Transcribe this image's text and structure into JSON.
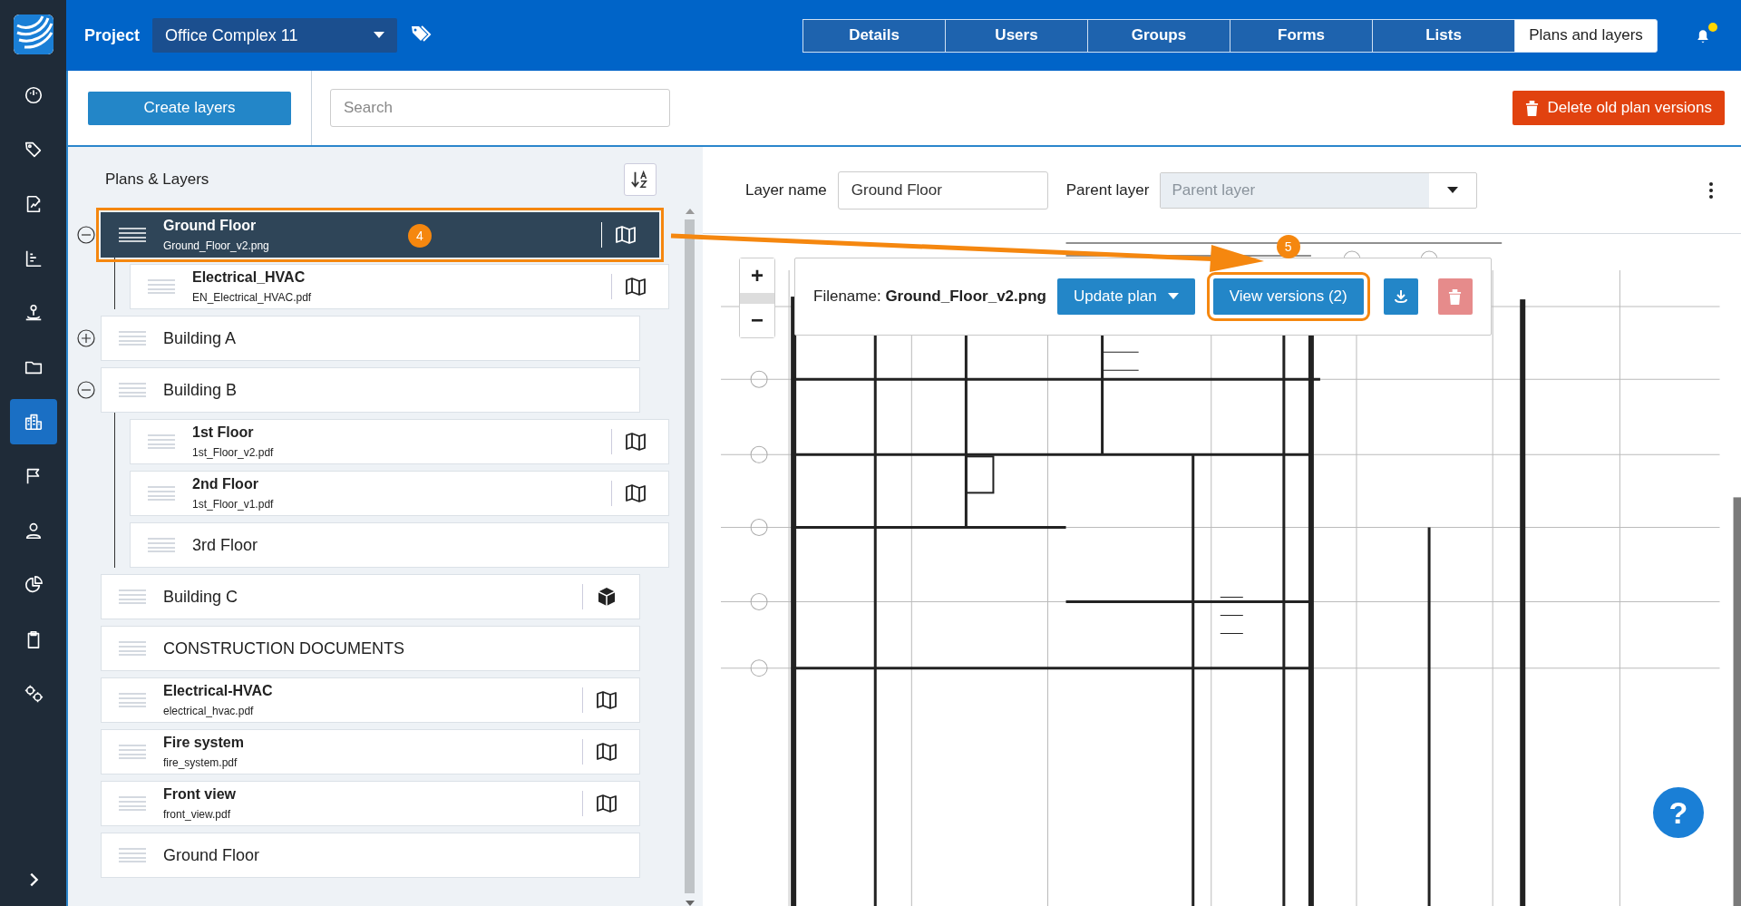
{
  "sidebar": {
    "items": [
      {
        "selected": false
      },
      {
        "selected": false
      },
      {
        "selected": false
      },
      {
        "selected": false
      },
      {
        "selected": false
      },
      {
        "selected": false
      },
      {
        "selected": true
      },
      {
        "selected": false
      },
      {
        "selected": false
      },
      {
        "selected": false
      },
      {
        "selected": false
      },
      {
        "selected": false
      }
    ]
  },
  "header": {
    "project_label": "Project",
    "project": "Office Complex 11",
    "tabs": [
      {
        "label": "Details",
        "selected": false
      },
      {
        "label": "Users",
        "selected": false
      },
      {
        "label": "Groups",
        "selected": false
      },
      {
        "label": "Forms",
        "selected": false
      },
      {
        "label": "Lists",
        "selected": false
      },
      {
        "label": "Plans and layers",
        "selected": true
      }
    ],
    "notifications": {
      "unread": true
    }
  },
  "toolbar": {
    "create_button": "Create layers",
    "search": {
      "placeholder": "Search"
    },
    "delete_button": "Delete old plan versions"
  },
  "tree": {
    "title": "Plans & Layers",
    "items": [
      {
        "name": "Ground Floor",
        "file": "Ground_Floor_v2.png",
        "kind": "plan",
        "selected": true,
        "callout": "4",
        "expanded": true,
        "children": [
          {
            "name": "Electrical_HVAC",
            "file": "EN_Electrical_HVAC.pdf",
            "kind": "plan",
            "selected": false
          }
        ]
      },
      {
        "name": "Building A",
        "kind": "folder",
        "selected": false,
        "expanded": false
      },
      {
        "name": "Building B",
        "kind": "folder",
        "selected": false,
        "expanded": true,
        "children": [
          {
            "name": "1st Floor",
            "file": "1st_Floor_v2.pdf",
            "kind": "plan",
            "selected": false
          },
          {
            "name": "2nd Floor",
            "file": "1st_Floor_v1.pdf",
            "kind": "plan",
            "selected": false
          },
          {
            "name": "3rd Floor",
            "kind": "folder",
            "selected": false
          }
        ]
      },
      {
        "name": "Building C",
        "kind": "model",
        "selected": false
      },
      {
        "name": "CONSTRUCTION DOCUMENTS",
        "kind": "folder",
        "selected": false
      },
      {
        "name": "Electrical-HVAC",
        "file": "electrical_hvac.pdf",
        "kind": "plan",
        "selected": false
      },
      {
        "name": "Fire system",
        "file": "fire_system.pdf",
        "kind": "plan",
        "selected": false
      },
      {
        "name": "Front view",
        "file": "front_view.pdf",
        "kind": "plan",
        "selected": false
      },
      {
        "name": "Ground Floor",
        "kind": "folder",
        "selected": false
      }
    ]
  },
  "detail": {
    "layer_name_label": "Layer name",
    "layer_name": "Ground Floor",
    "parent_label": "Parent layer",
    "parent_placeholder": "Parent layer",
    "plan": {
      "kind": "picture",
      "zoom_in": "+",
      "zoom_out": "−",
      "filename_label": "Filename:",
      "filename": "Ground_Floor_v2.png",
      "update_button": "Update plan",
      "versions_button": {
        "label": "View versions (2)",
        "callout": "5"
      },
      "help": "?"
    }
  }
}
